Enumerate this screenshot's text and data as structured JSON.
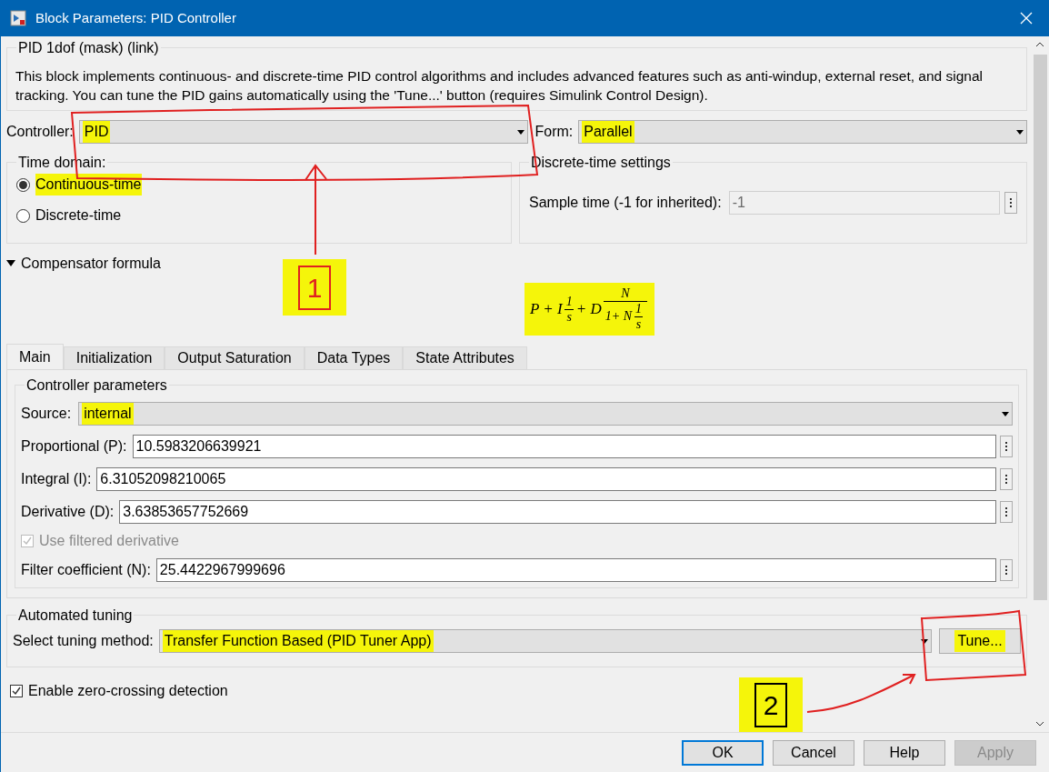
{
  "window": {
    "title": "Block Parameters: PID Controller"
  },
  "block": {
    "title": "PID 1dof (mask) (link)",
    "description": "This block implements continuous- and discrete-time PID control algorithms and includes advanced features such as anti-windup, external reset, and signal tracking. You can tune the PID gains automatically using the 'Tune...' button (requires Simulink Control Design)."
  },
  "controller": {
    "label": "Controller:",
    "value": "PID",
    "highlighted": true
  },
  "form": {
    "label": "Form:",
    "value": "Parallel",
    "highlighted": true
  },
  "time_domain": {
    "title": "Time domain:",
    "options": [
      {
        "label": "Continuous-time",
        "selected": true,
        "highlighted": true
      },
      {
        "label": "Discrete-time",
        "selected": false,
        "highlighted": false
      }
    ]
  },
  "discrete_settings": {
    "title": "Discrete-time settings",
    "label": "Sample time (-1 for inherited):",
    "value": "-1",
    "disabled": true
  },
  "compensator": {
    "label": "Compensator formula",
    "expanded": true,
    "highlighted": true,
    "formula": [
      {
        "kind": "text",
        "text": "P + I"
      },
      {
        "kind": "frac",
        "num": [
          {
            "kind": "text",
            "text": "1"
          }
        ],
        "den": [
          {
            "kind": "text",
            "text": "s"
          }
        ]
      },
      {
        "kind": "text",
        "text": "+ D"
      },
      {
        "kind": "frac",
        "num": [
          {
            "kind": "text",
            "text": "N"
          }
        ],
        "den": [
          {
            "kind": "text",
            "text": "1+ N"
          },
          {
            "kind": "frac",
            "num": [
              {
                "kind": "text",
                "text": "1"
              }
            ],
            "den": [
              {
                "kind": "text",
                "text": "s"
              }
            ]
          }
        ]
      }
    ]
  },
  "tabs": [
    {
      "label": "Main",
      "selected": true
    },
    {
      "label": "Initialization",
      "selected": false
    },
    {
      "label": "Output Saturation",
      "selected": false
    },
    {
      "label": "Data Types",
      "selected": false
    },
    {
      "label": "State Attributes",
      "selected": false
    }
  ],
  "controller_parameters": {
    "title": "Controller parameters",
    "source": {
      "label": "Source:",
      "value": "internal",
      "highlighted": true
    },
    "rows": [
      {
        "kind": "field",
        "label": "Proportional (P):",
        "value": "10.5983206639921"
      },
      {
        "kind": "field",
        "label": "Integral (I):",
        "value": "6.31052098210065"
      },
      {
        "kind": "field",
        "label": "Derivative (D):",
        "value": "3.63853657752669"
      },
      {
        "kind": "checkbox",
        "label": "Use filtered derivative",
        "checked": true,
        "disabled": true
      },
      {
        "kind": "field",
        "label": "Filter coefficient (N):",
        "value": "25.4422967999696"
      }
    ]
  },
  "automated_tuning": {
    "title": "Automated tuning",
    "label": "Select tuning method:",
    "value": "Transfer Function Based (PID Tuner App)",
    "highlighted": true,
    "button": "Tune...",
    "button_highlighted": true
  },
  "zero_crossing": {
    "label": "Enable zero-crossing detection",
    "checked": true
  },
  "buttons": [
    {
      "label": "OK",
      "kind": "default"
    },
    {
      "label": "Cancel",
      "kind": "normal"
    },
    {
      "label": "Help",
      "kind": "normal"
    },
    {
      "label": "Apply",
      "kind": "disabled"
    }
  ],
  "annotations": [
    {
      "label": "1",
      "kind": "red"
    },
    {
      "label": "2",
      "kind": "black"
    }
  ]
}
